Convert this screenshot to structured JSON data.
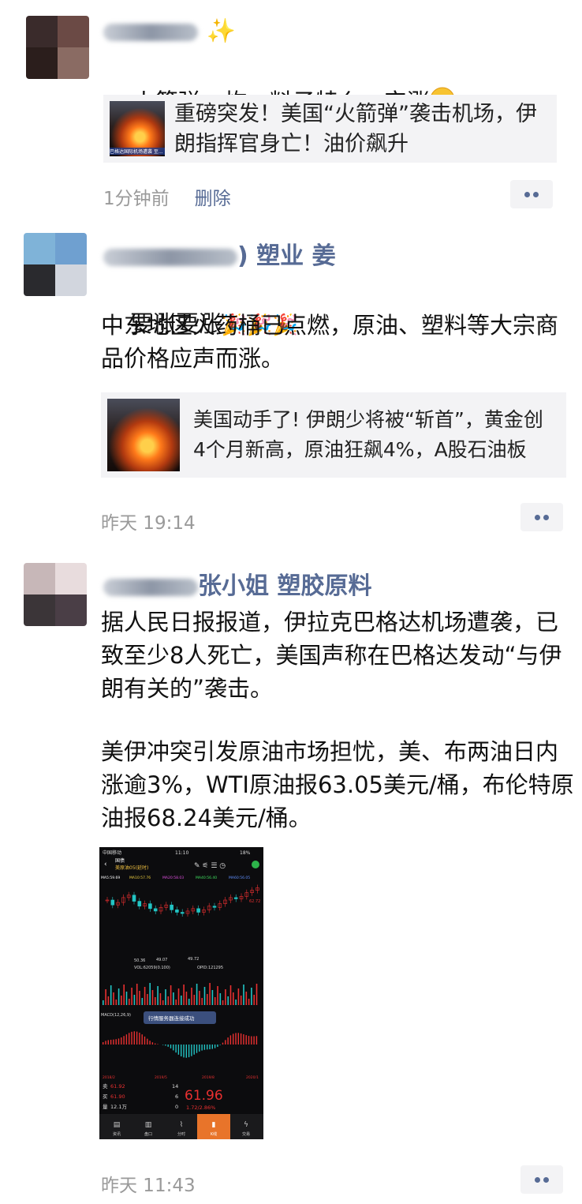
{
  "posts": [
    {
      "name_visible": "",
      "text": "火箭弹一炸，料子特么一定涨",
      "link_title": "重磅突发！美国“火箭弹”袭击机场，伊朗指挥官身亡！油价飙升",
      "link_thumb_caption": "巴格达国际机场遭袭 至...",
      "time": "1分钟前",
      "delete_label": "删除"
    },
    {
      "name_visible": ") 塑业 姜",
      "text": "要涨要涨",
      "text2": "中东地区火药桶已点燃，原油、塑料等大宗商品价格应声而涨。",
      "link_title": "美国动手了! 伊朗少将被“斩首”，黄金创4个月新高，原油狂飙4%，A股石油板块...",
      "time": "昨天 19:14"
    },
    {
      "name_visible": "张小姐 塑胶原料",
      "text": "据人民日报报道，伊拉克巴格达机场遭袭，已致至少8人死亡，美国声称在巴格达发动“与伊朗有关的”袭击。",
      "text2": "美伊冲突引发原油市场担忧，美、布两油日内涨逾3%，WTI原油报63.05美元/桶，布伦特原油报68.24美元/桶。",
      "time": "昨天 11:43"
    }
  ],
  "screenshot": {
    "status_carrier": "中国移动",
    "status_time": "11:10",
    "status_battery": "18%",
    "tab_title": "国债",
    "symbol": "美原油05(延时)",
    "ma_labels": [
      "MA5:59.69",
      "MA10:57.76",
      "MA20:58.03",
      "MA40:56.40",
      "MA60:56.05"
    ],
    "vol_label": "VOL:62059(0.100)",
    "opid_label": "OPID:121295",
    "macd_label": "MACD(12,26,9)",
    "toast": "行情服务器连接成功",
    "dates": [
      "2018/2",
      "2019/5",
      "2019/8",
      "2020/1"
    ],
    "sell_label": "卖",
    "sell_price": "61.92",
    "buy_label": "买",
    "buy_price": "61.90",
    "vol_label_cn": "量",
    "volume": "12.1万",
    "sell_qty": "14",
    "buy_qty": "6",
    "zero": "0",
    "last_price": "61.96",
    "change": "1.72/2.86%",
    "high_price": "62.72",
    "low_marks": [
      "50.36",
      "49.07",
      "49.72"
    ],
    "tabs": [
      "资讯",
      "盘口",
      "分时",
      "K线",
      "交易"
    ]
  },
  "colors": {
    "name": "#576b95",
    "rise": "#e93030",
    "fall": "#22c4c4"
  }
}
